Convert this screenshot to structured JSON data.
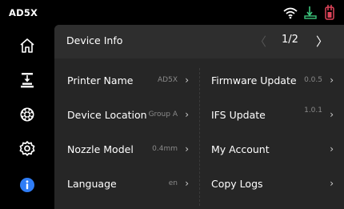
{
  "status_bar": {
    "device_name": "AD5X",
    "icons": [
      "wifi-icon",
      "printer-status-icon",
      "filament-icon"
    ]
  },
  "sidebar": {
    "items": [
      {
        "name": "home-icon"
      },
      {
        "name": "print-job-icon"
      },
      {
        "name": "filament-spool-icon"
      },
      {
        "name": "settings-gear-icon"
      },
      {
        "name": "info-icon",
        "active": true
      }
    ]
  },
  "header": {
    "title": "Device Info",
    "page": "1/2",
    "prev": "〈",
    "next": "〉"
  },
  "left_rows": [
    {
      "label": "Printer Name",
      "value": "AD5X"
    },
    {
      "label": "Device Location",
      "value": "Group A"
    },
    {
      "label": "Nozzle Model",
      "value": "0.4mm"
    },
    {
      "label": "Language",
      "value": "en"
    }
  ],
  "right_rows": [
    {
      "label": "Firmware Update",
      "value": "0.0.5"
    },
    {
      "label": "IFS Update",
      "value": "1.0.1"
    },
    {
      "label": "My Account",
      "value": ""
    },
    {
      "label": "Copy Logs",
      "value": ""
    }
  ],
  "chevron": "›",
  "colors": {
    "background": "#000000",
    "panel": "#262626",
    "active_icon": "#2f7df6",
    "status_green": "#3cc47c",
    "status_red": "#e0445a"
  }
}
